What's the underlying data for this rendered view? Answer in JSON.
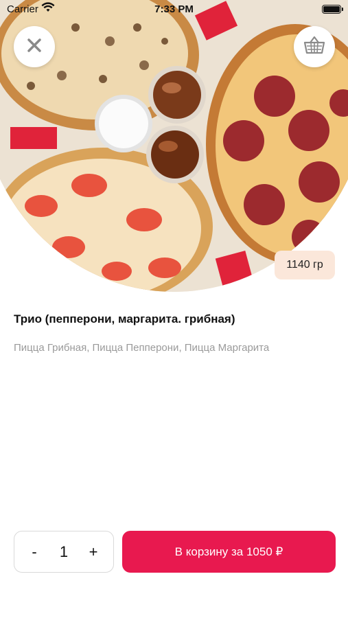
{
  "status_bar": {
    "carrier": "Carrier",
    "time": "7:33 PM"
  },
  "hero": {
    "image": "pizza-trio-photo",
    "close_icon": "close-icon",
    "basket_icon": "basket-icon",
    "weight": "1140 гр"
  },
  "product": {
    "title": "Трио (пепперони, маргарита. грибная)",
    "description": "Пицца Грибная, Пицца Пепперони, Пицца Маргарита"
  },
  "stepper": {
    "minus": "-",
    "quantity": "1",
    "plus": "+"
  },
  "cart": {
    "label": "В корзину за 1050 ₽"
  },
  "colors": {
    "accent": "#e8194f",
    "weight_badge": "#fbe7da",
    "description_text": "#9a9a9a"
  }
}
